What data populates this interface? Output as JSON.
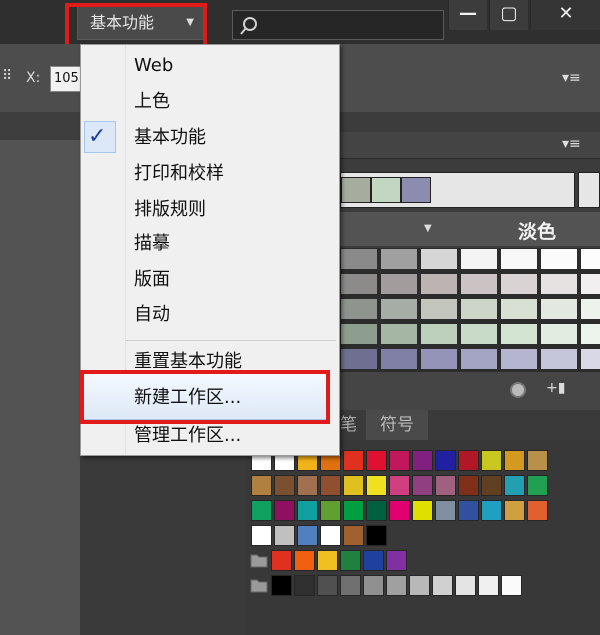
{
  "header": {
    "workspace_button": "基本功能",
    "caret": "⌄",
    "search_placeholder": ""
  },
  "window": {
    "minimize": "—",
    "restore": "▢",
    "close": "✕"
  },
  "control": {
    "x_label": "X:",
    "x_value": "105"
  },
  "menu": {
    "items": [
      "Web",
      "上色",
      "基本功能",
      "打印和校样",
      "排版规则",
      "描摹",
      "版面",
      "自动"
    ],
    "reset": "重置基本功能",
    "new_workspace": "新建工作区...",
    "manage_workspace": "管理工作区..."
  },
  "panels": {
    "harmony_label": "淡色",
    "tab_partial": "笔",
    "tab_symbols": "符号"
  },
  "colors": {
    "highlight_red": "#e21a1a",
    "check_blue": "#1e3f9c"
  }
}
